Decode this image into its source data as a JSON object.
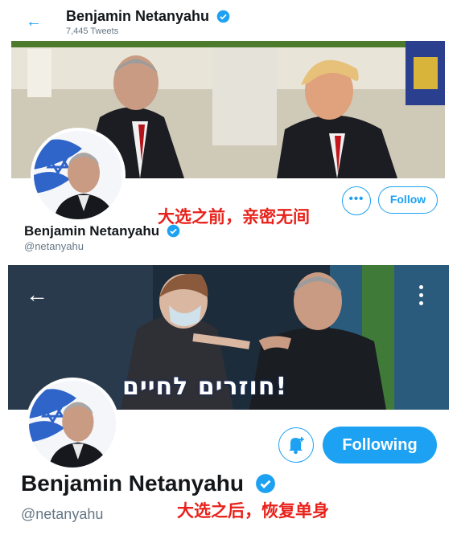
{
  "before": {
    "header": {
      "back_icon": "arrow-left-icon",
      "display_name": "Benjamin Netanyahu",
      "tweet_count": "7,445 Tweets"
    },
    "banner_icon": "photo-two-leaders-meeting",
    "avatar_icon": "profile-photo-with-flag",
    "more_icon": "more-dots-icon",
    "more_label": "•••",
    "follow_label": "Follow",
    "caption": "大选之前，亲密无间",
    "display_name": "Benjamin Netanyahu",
    "handle": "@netanyahu",
    "verified_icon": "verified-badge-icon"
  },
  "after": {
    "back_icon": "arrow-left-icon",
    "more_icon": "vertical-dots-icon",
    "banner_icon": "photo-vaccination",
    "banner_text": "!חוזרים לחיים",
    "avatar_icon": "profile-photo-with-flag",
    "bell_icon": "notification-bell-icon",
    "following_label": "Following",
    "display_name": "Benjamin Netanyahu",
    "handle": "@netanyahu",
    "verified_icon": "verified-badge-icon",
    "caption": "大选之后，恢复单身"
  },
  "colors": {
    "twitter_blue": "#1da1f2",
    "caption_red": "#e8221b",
    "handle_gray": "#657786",
    "name_black": "#14171a"
  }
}
